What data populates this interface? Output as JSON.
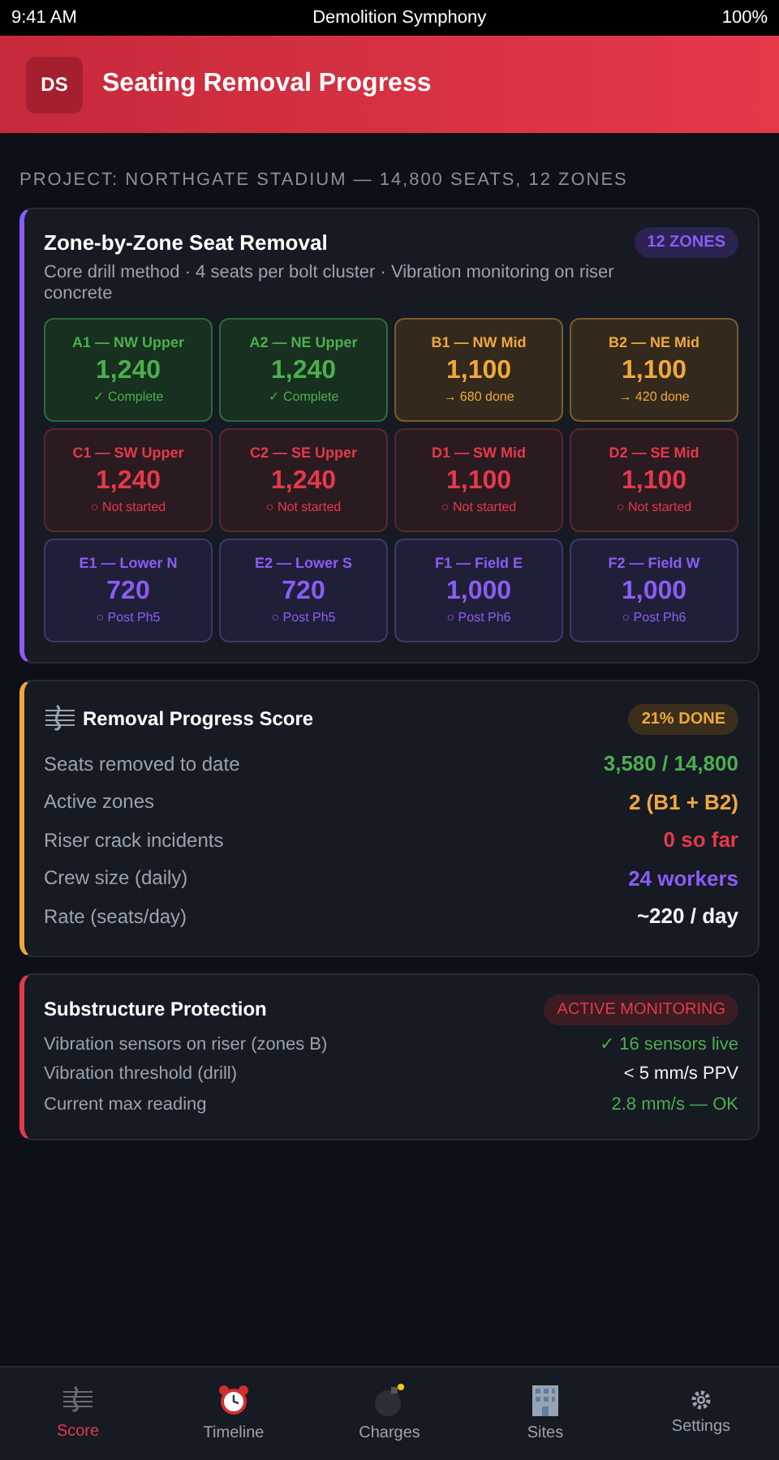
{
  "status_bar": {
    "time": "9:41 AM",
    "title": "Demolition Symphony",
    "battery": "100%"
  },
  "header": {
    "logo": "DS",
    "title": "Seating Removal Progress"
  },
  "project_label": "PROJECT: NORTHGATE STADIUM — 14,800 SEATS, 12 ZONES",
  "zone_card": {
    "title": "Zone-by-Zone Seat Removal",
    "badge": "12 ZONES",
    "subtitle": "Core drill method · 4 seats per bolt cluster · Vibration monitoring on riser concrete",
    "zones": [
      {
        "name": "A1 — NW Upper",
        "seats": "1,240",
        "note": "✓ Complete",
        "kind": "complete"
      },
      {
        "name": "A2 — NE Upper",
        "seats": "1,240",
        "note": "✓ Complete",
        "kind": "complete"
      },
      {
        "name": "B1 — NW Mid",
        "seats": "1,100",
        "note": "→ 680 done",
        "kind": "active"
      },
      {
        "name": "B2 — NE Mid",
        "seats": "1,100",
        "note": "→ 420 done",
        "kind": "active"
      },
      {
        "name": "C1 — SW Upper",
        "seats": "1,240",
        "note": "○ Not started",
        "kind": "not_started"
      },
      {
        "name": "C2 — SE Upper",
        "seats": "1,240",
        "note": "○ Not started",
        "kind": "not_started"
      },
      {
        "name": "D1 — SW Mid",
        "seats": "1,100",
        "note": "○ Not started",
        "kind": "not_started"
      },
      {
        "name": "D2 — SE Mid",
        "seats": "1,100",
        "note": "○ Not started",
        "kind": "not_started"
      },
      {
        "name": "E1 — Lower N",
        "seats": "720",
        "note": "○ Post Ph5",
        "kind": "later"
      },
      {
        "name": "E2 — Lower S",
        "seats": "720",
        "note": "○ Post Ph5",
        "kind": "later"
      },
      {
        "name": "F1 — Field E",
        "seats": "1,000",
        "note": "○ Post Ph6",
        "kind": "later"
      },
      {
        "name": "F2 — Field W",
        "seats": "1,000",
        "note": "○ Post Ph6",
        "kind": "later"
      }
    ]
  },
  "score_card": {
    "title": "Removal Progress Score",
    "badge": "21% DONE",
    "rows": [
      {
        "label": "Seats removed to date",
        "value": "3,580 / 14,800",
        "color": "#4caf50"
      },
      {
        "label": "Active zones",
        "value": "2 (B1 + B2)",
        "color": "#f0a83c"
      },
      {
        "label": "Riser crack incidents",
        "value": "0 so far",
        "color": "#e5394a"
      },
      {
        "label": "Crew size (daily)",
        "value": "24 workers",
        "color": "#8b5cf6"
      },
      {
        "label": "Rate (seats/day)",
        "value": "~220 / day",
        "color": "#f3f4f6"
      }
    ]
  },
  "protection_card": {
    "title": "Substructure Protection",
    "badge": "ACTIVE MONITORING",
    "rows": [
      {
        "label": "Vibration sensors on riser (zones B)",
        "value": "✓ 16 sensors live",
        "color": "#4caf50"
      },
      {
        "label": "Vibration threshold (drill)",
        "value": "< 5 mm/s PPV",
        "color": "#f3f4f6"
      },
      {
        "label": "Current max reading",
        "value": "2.8 mm/s — OK",
        "color": "#4caf50"
      }
    ]
  },
  "nav": [
    {
      "label": "Score",
      "kind": "score",
      "selected": true
    },
    {
      "label": "Timeline",
      "kind": "clock",
      "selected": false
    },
    {
      "label": "Charges",
      "kind": "bomb",
      "selected": false
    },
    {
      "label": "Sites",
      "kind": "building",
      "selected": false
    },
    {
      "label": "Settings",
      "kind": "gear",
      "selected": false
    }
  ]
}
